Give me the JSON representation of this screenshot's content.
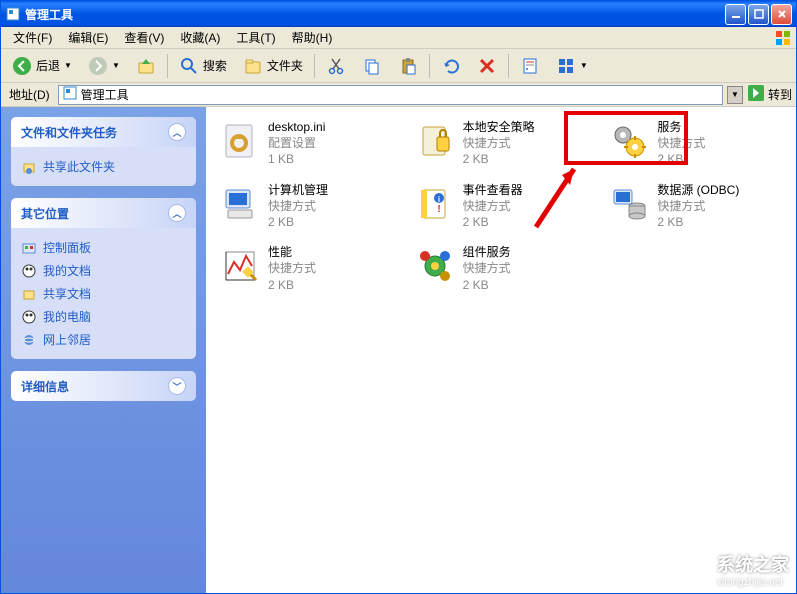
{
  "window": {
    "title": "管理工具"
  },
  "menus": {
    "file": "文件(F)",
    "edit": "编辑(E)",
    "view": "查看(V)",
    "favorites": "收藏(A)",
    "tools": "工具(T)",
    "help": "帮助(H)"
  },
  "toolbar": {
    "back": "后退",
    "search": "搜索",
    "folders": "文件夹"
  },
  "address": {
    "label": "地址(D)",
    "value": "管理工具",
    "go": "转到"
  },
  "sidebar": {
    "tasks": {
      "title": "文件和文件夹任务",
      "items": [
        {
          "label": "共享此文件夹"
        }
      ]
    },
    "places": {
      "title": "其它位置",
      "items": [
        {
          "label": "控制面板"
        },
        {
          "label": "我的文档"
        },
        {
          "label": "共享文档"
        },
        {
          "label": "我的电脑"
        },
        {
          "label": "网上邻居"
        }
      ]
    },
    "details": {
      "title": "详细信息"
    }
  },
  "items": [
    {
      "name": "desktop.ini",
      "sub1": "配置设置",
      "sub2": "1 KB"
    },
    {
      "name": "本地安全策略",
      "sub1": "快捷方式",
      "sub2": "2 KB"
    },
    {
      "name": "服务",
      "sub1": "快捷方式",
      "sub2": "2 KB"
    },
    {
      "name": "计算机管理",
      "sub1": "快捷方式",
      "sub2": "2 KB"
    },
    {
      "name": "事件查看器",
      "sub1": "快捷方式",
      "sub2": "2 KB"
    },
    {
      "name": "数据源 (ODBC)",
      "sub1": "快捷方式",
      "sub2": "2 KB"
    },
    {
      "name": "性能",
      "sub1": "快捷方式",
      "sub2": "2 KB"
    },
    {
      "name": "组件服务",
      "sub1": "快捷方式",
      "sub2": "2 KB"
    }
  ],
  "watermark": {
    "brand": "系统之家",
    "url": "xitongzhijia.net"
  }
}
